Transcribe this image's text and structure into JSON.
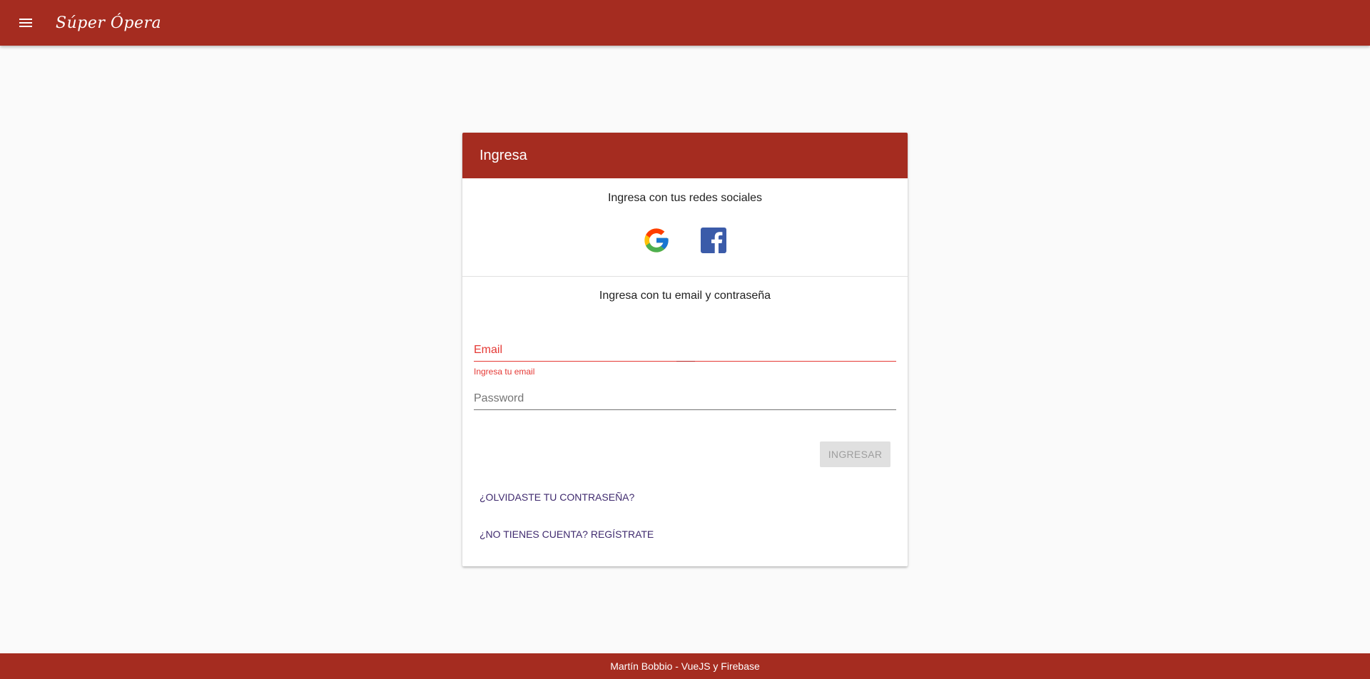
{
  "app": {
    "brand": "Súper Ópera",
    "menu_icon": "hamburger-menu-icon"
  },
  "card": {
    "title": "Ingresa",
    "social": {
      "label": "Ingresa con tus redes sociales",
      "providers": [
        "google-icon",
        "facebook-icon"
      ]
    },
    "email_login": {
      "label": "Ingresa con tu email y contraseña",
      "email_placeholder": "Email",
      "email_error": "Ingresa tu email",
      "password_placeholder": "Password",
      "submit_label": "INGRESAR"
    },
    "links": {
      "forgot": "¿OLVIDASTE TU CONTRASEÑA?",
      "register": "¿NO TIENES CUENTA? REGÍSTRATE"
    }
  },
  "footer": {
    "text": "Martín Bobbio - VueJS y Firebase"
  },
  "colors": {
    "primary": "#a52c20",
    "error": "#e53935",
    "link": "#3f2a6e",
    "facebook": "#3b5ba9"
  }
}
